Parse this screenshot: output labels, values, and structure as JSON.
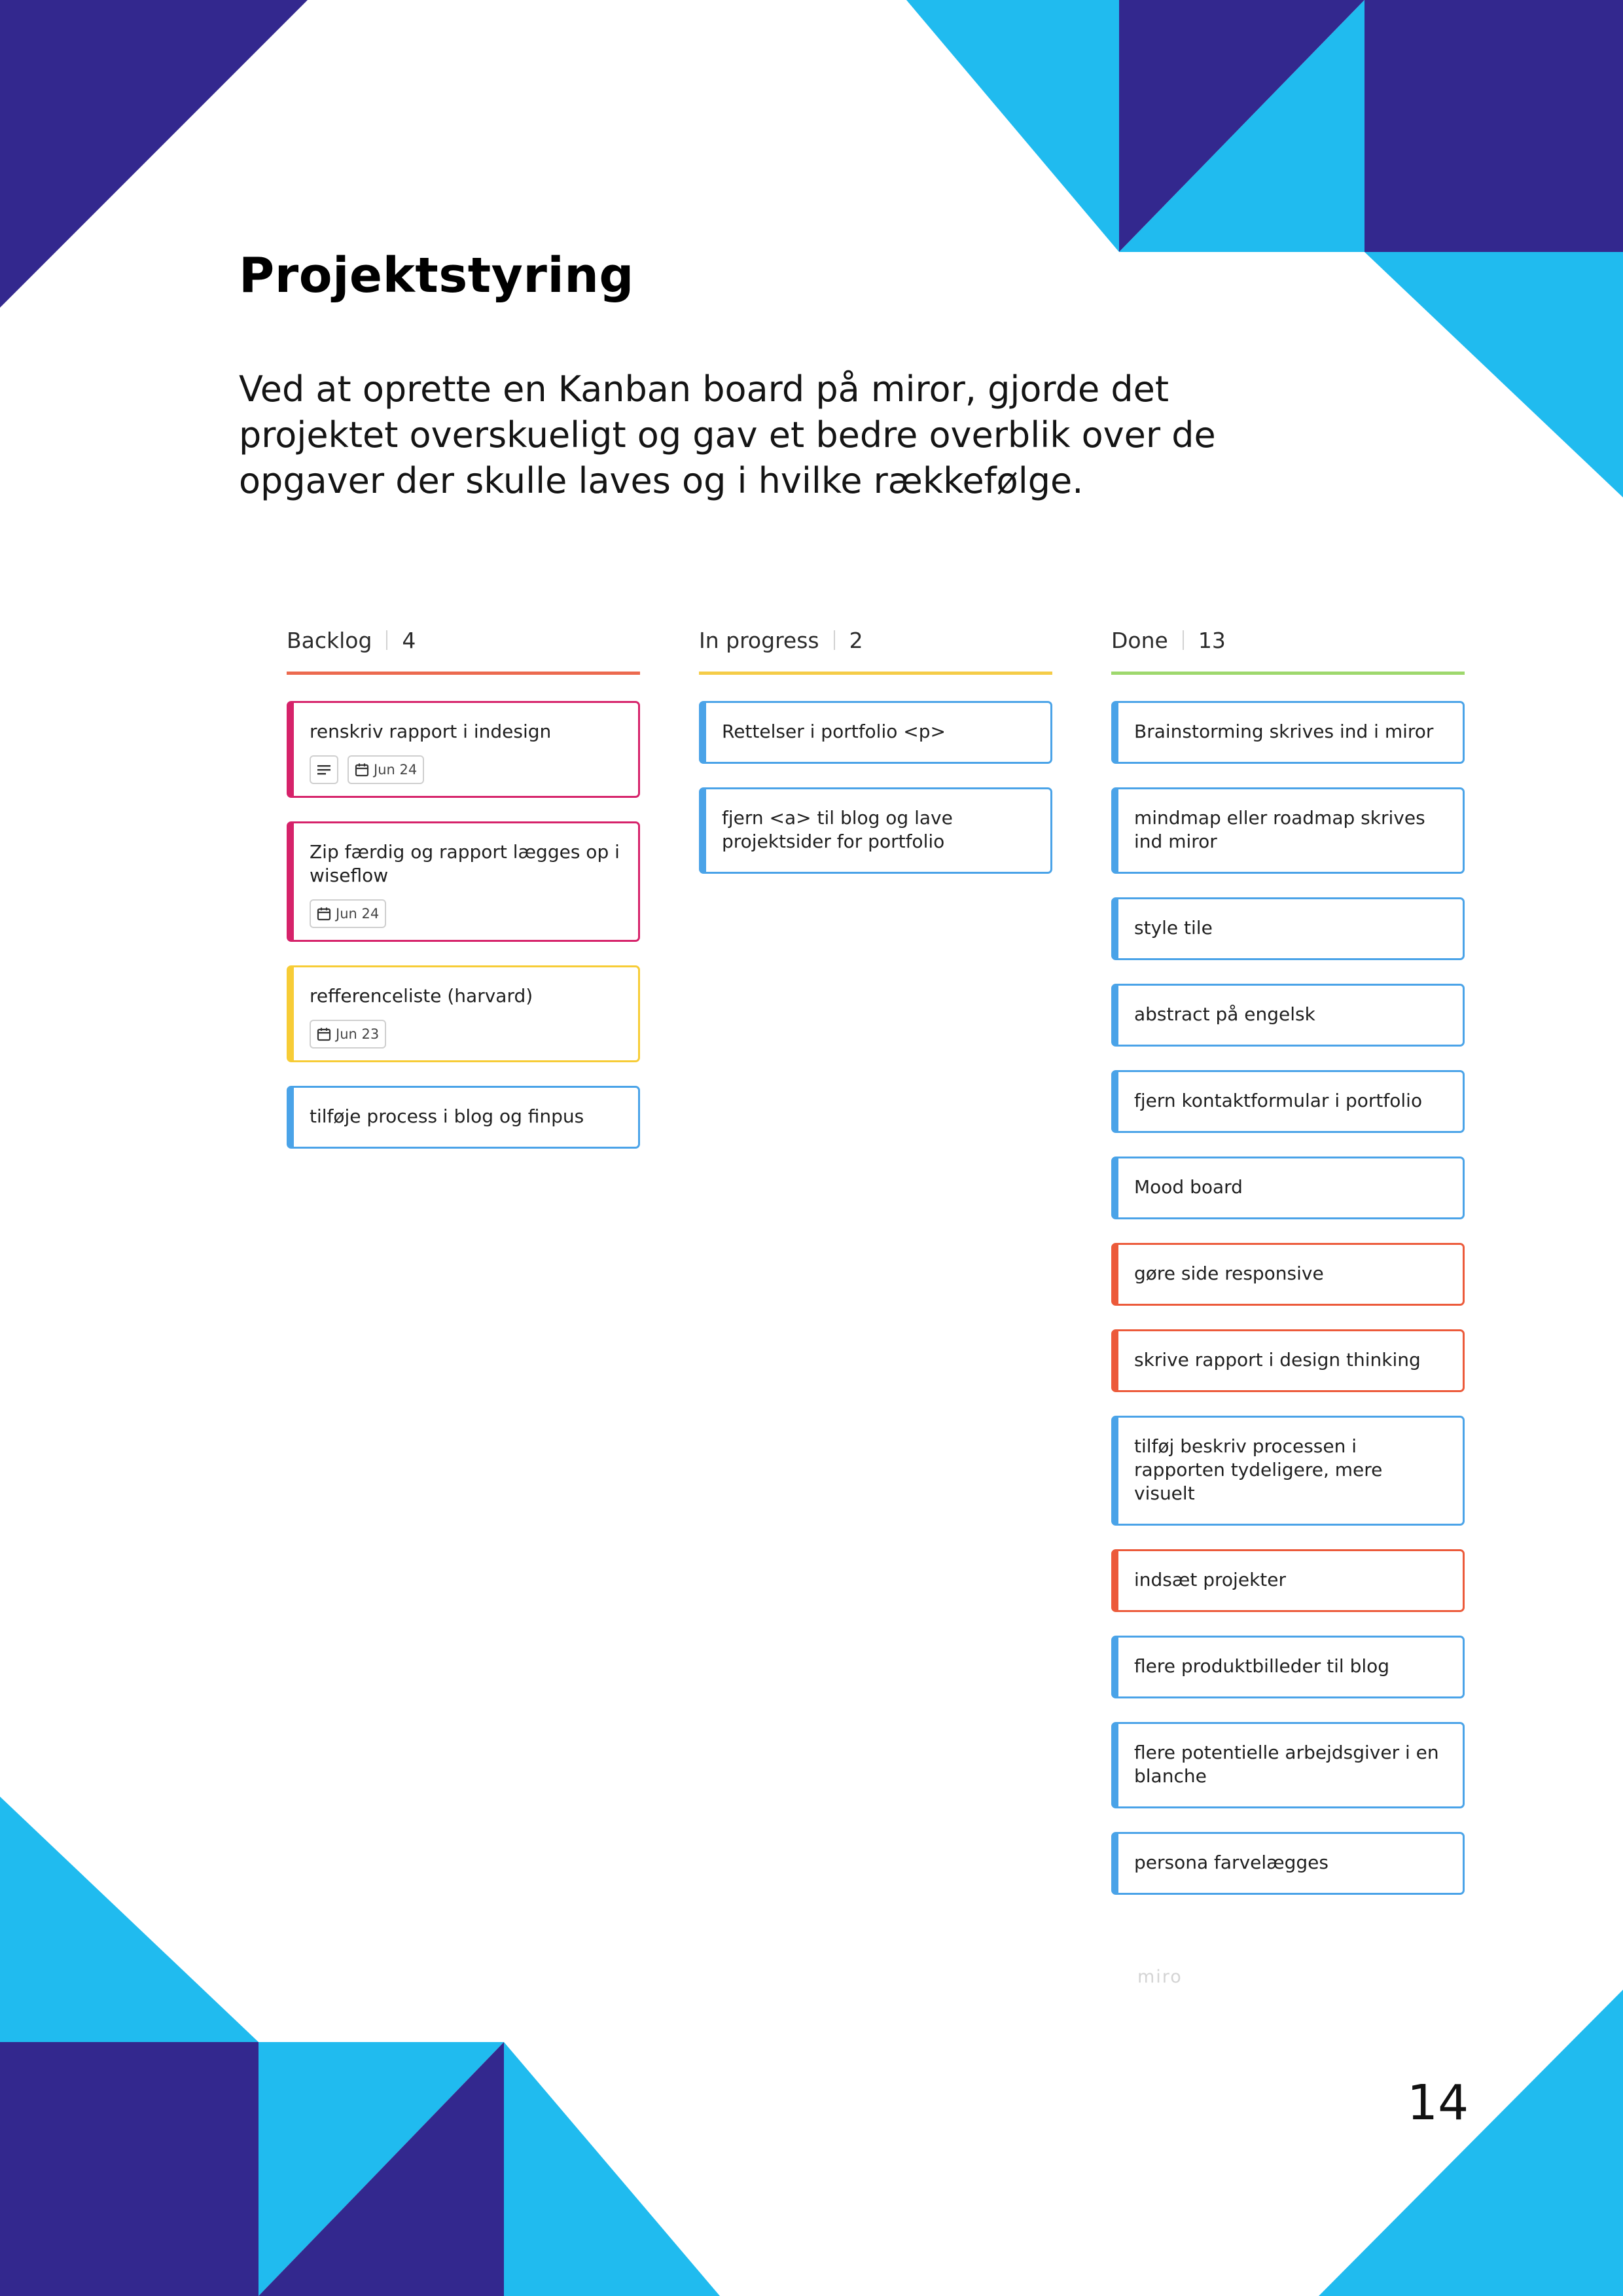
{
  "colors": {
    "navy": "#33288e",
    "cyan": "#20bbef",
    "card_blue": "#4aa3e8",
    "card_pink": "#d6226a",
    "card_yellow": "#f7cc36",
    "card_red": "#ec5a3a",
    "line_backlog": "#ec6a4f",
    "line_progress": "#f5cc48",
    "line_done": "#9ed86d"
  },
  "page": {
    "title": "Projektstyring",
    "intro": "Ved at oprette en Kanban board på miror, gjorde det projektet overskueligt og gav et bedre overblik over de opgaver der skulle laves og i hvilke rækkefølge.",
    "board_watermark": "miro",
    "page_number": "14"
  },
  "board": {
    "columns": [
      {
        "name": "Backlog",
        "count": "4",
        "line_color": "#ec6a4f",
        "cards": [
          {
            "title": "renskriv rapport i indesign",
            "color": "#d6226a",
            "has_notes": true,
            "date": "Jun 24"
          },
          {
            "title": "Zip færdig og rapport lægges op i wiseflow",
            "color": "#d6226a",
            "has_notes": false,
            "date": "Jun 24"
          },
          {
            "title": "refferenceliste (harvard)",
            "color": "#f7cc36",
            "has_notes": false,
            "date": "Jun 23"
          },
          {
            "title": "tilføje process i blog og finpus",
            "color": "#4aa3e8",
            "has_notes": false,
            "date": ""
          }
        ]
      },
      {
        "name": "In progress",
        "count": "2",
        "line_color": "#f5cc48",
        "cards": [
          {
            "title": "Rettelser i portfolio <p>",
            "color": "#4aa3e8",
            "has_notes": false,
            "date": ""
          },
          {
            "title": "fjern <a> til blog og lave projektsider for portfolio",
            "color": "#4aa3e8",
            "has_notes": false,
            "date": ""
          }
        ]
      },
      {
        "name": "Done",
        "count": "13",
        "line_color": "#9ed86d",
        "cards": [
          {
            "title": "Brainstorming skrives ind i miror",
            "color": "#4aa3e8",
            "has_notes": false,
            "date": ""
          },
          {
            "title": "mindmap eller roadmap skrives ind miror",
            "color": "#4aa3e8",
            "has_notes": false,
            "date": ""
          },
          {
            "title": "style tile",
            "color": "#4aa3e8",
            "has_notes": false,
            "date": ""
          },
          {
            "title": "abstract på engelsk",
            "color": "#4aa3e8",
            "has_notes": false,
            "date": ""
          },
          {
            "title": "fjern kontaktformular i portfolio",
            "color": "#4aa3e8",
            "has_notes": false,
            "date": ""
          },
          {
            "title": "Mood board",
            "color": "#4aa3e8",
            "has_notes": false,
            "date": ""
          },
          {
            "title": "gøre side responsive",
            "color": "#ec5a3a",
            "has_notes": false,
            "date": ""
          },
          {
            "title": "skrive rapport i design thinking",
            "color": "#ec5a3a",
            "has_notes": false,
            "date": ""
          },
          {
            "title": "tilføj beskriv processen i rapporten tydeligere, mere visuelt",
            "color": "#4aa3e8",
            "has_notes": false,
            "date": ""
          },
          {
            "title": "indsæt projekter",
            "color": "#ec5a3a",
            "has_notes": false,
            "date": ""
          },
          {
            "title": "flere produktbilleder til blog",
            "color": "#4aa3e8",
            "has_notes": false,
            "date": ""
          },
          {
            "title": "flere potentielle arbejdsgiver i en blanche",
            "color": "#4aa3e8",
            "has_notes": false,
            "date": ""
          },
          {
            "title": "persona farvelægges",
            "color": "#4aa3e8",
            "has_notes": false,
            "date": ""
          }
        ]
      }
    ]
  }
}
